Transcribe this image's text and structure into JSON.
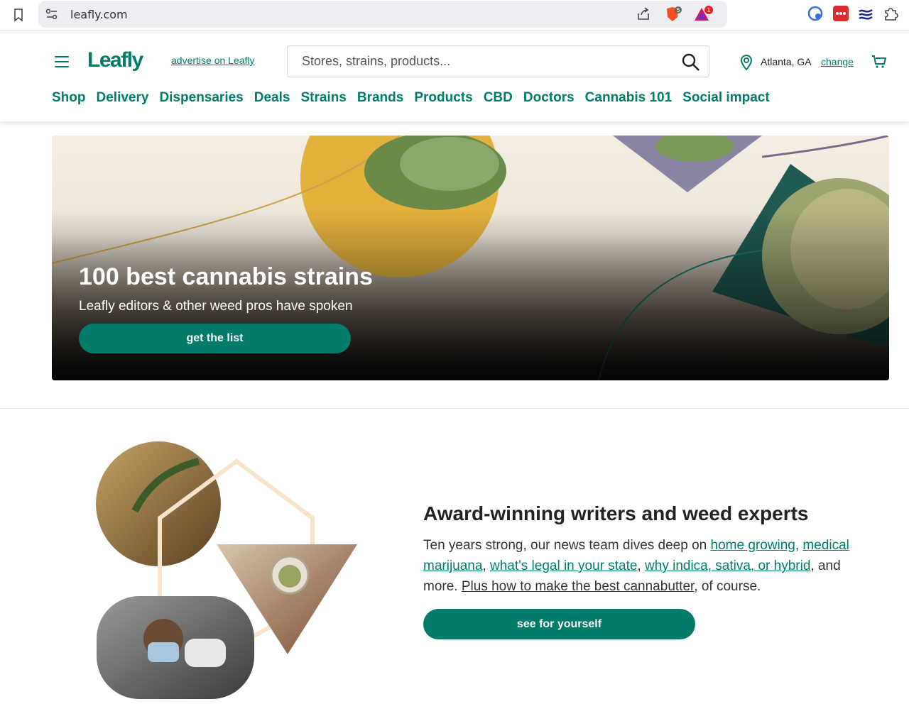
{
  "browser": {
    "url": "leafly.com",
    "extensions": [
      {
        "icon": "brave-shield-icon",
        "badge": "5"
      },
      {
        "icon": "brave-rewards-icon",
        "badge": "1"
      }
    ]
  },
  "header": {
    "logo": "Leafly",
    "advertise_link": "advertise on Leafly",
    "search_placeholder": "Stores, strains, products...",
    "location": "Atlanta, GA",
    "change_link": "change",
    "nav": [
      "Shop",
      "Delivery",
      "Dispensaries",
      "Deals",
      "Strains",
      "Brands",
      "Products",
      "CBD",
      "Doctors",
      "Cannabis 101",
      "Social impact"
    ]
  },
  "hero": {
    "title": "100 best cannabis strains",
    "subtitle": "Leafly editors & other weed pros have spoken",
    "button": "get the list"
  },
  "section": {
    "title": "Award-winning writers and weed experts",
    "body_intro": "Ten years strong, our news team dives deep on ",
    "link_home_growing": "home growing",
    "sep1": ", ",
    "link_medical": "medical marijuana",
    "sep2": ", ",
    "link_legal": "what's legal in your state",
    "sep3": ", ",
    "link_indica": "why indica, sativa, or hybrid",
    "body_mid": ", and more. ",
    "link_cannabutter": "Plus how to make the best cannabutter",
    "body_end": ", of course.",
    "button": "see for yourself"
  },
  "colors": {
    "brand": "#017c6b"
  }
}
